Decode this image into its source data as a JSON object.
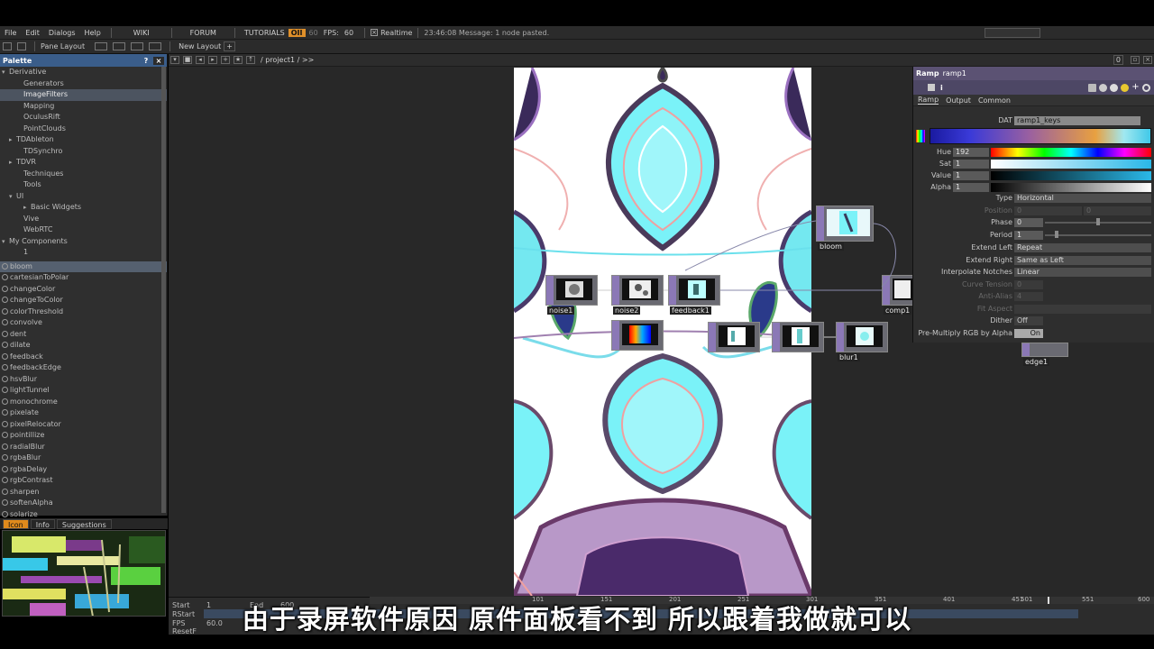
{
  "menubar": {
    "items": [
      "File",
      "Edit",
      "Dialogs",
      "Help"
    ],
    "wiki": "WIKI",
    "forum": "FORUM",
    "tutorials": "TUTORIALS",
    "oi": "OII",
    "sixty": "60",
    "fps_label": "FPS:",
    "fps_value": "60",
    "realtime": "Realtime",
    "message": "23:46:08 Message: 1 node pasted."
  },
  "toolbar2": {
    "pane_layout": "Pane Layout",
    "new_layout": "New Layout",
    "plus": "+"
  },
  "palette": {
    "title": "Palette",
    "help": "?",
    "close": "×",
    "tree": [
      {
        "label": "Derivative",
        "indent": 0,
        "tri": "▾"
      },
      {
        "label": "Generators",
        "indent": 2,
        "tri": ""
      },
      {
        "label": "ImageFilters",
        "indent": 2,
        "tri": "",
        "selected": true
      },
      {
        "label": "Mapping",
        "indent": 2,
        "tri": ""
      },
      {
        "label": "OculusRift",
        "indent": 2,
        "tri": ""
      },
      {
        "label": "PointClouds",
        "indent": 2,
        "tri": ""
      },
      {
        "label": "TDAbleton",
        "indent": 1,
        "tri": "▸"
      },
      {
        "label": "TDSynchro",
        "indent": 2,
        "tri": ""
      },
      {
        "label": "TDVR",
        "indent": 1,
        "tri": "▸"
      },
      {
        "label": "Techniques",
        "indent": 2,
        "tri": ""
      },
      {
        "label": "Tools",
        "indent": 2,
        "tri": ""
      },
      {
        "label": "UI",
        "indent": 1,
        "tri": "▾"
      },
      {
        "label": "Basic Widgets",
        "indent": 3,
        "tri": "▸"
      },
      {
        "label": "Vive",
        "indent": 2,
        "tri": ""
      },
      {
        "label": "WebRTC",
        "indent": 2,
        "tri": ""
      },
      {
        "label": "My Components",
        "indent": 0,
        "tri": "▾"
      },
      {
        "label": "1",
        "indent": 2,
        "tri": ""
      }
    ],
    "components": [
      "bloom",
      "cartesianToPolar",
      "changeColor",
      "changeToColor",
      "colorThreshold",
      "convolve",
      "dent",
      "dilate",
      "feedback",
      "feedbackEdge",
      "hsvBlur",
      "lightTunnel",
      "monochrome",
      "pixelate",
      "pixelRelocator",
      "pointillize",
      "radialBlur",
      "rgbaBlur",
      "rgbaDelay",
      "rgbContrast",
      "sharpen",
      "softenAlpha",
      "solarize"
    ],
    "tabs": [
      "Icon",
      "Info",
      "Suggestions"
    ]
  },
  "network": {
    "path": "/ project1 / >>",
    "page_num": "0",
    "nodes": [
      {
        "id": "bloom",
        "label": "bloom"
      },
      {
        "id": "noise1",
        "label": "noise1"
      },
      {
        "id": "noise2",
        "label": "noise2"
      },
      {
        "id": "feedback",
        "label": "feedback1"
      },
      {
        "id": "ramp",
        "label": ""
      },
      {
        "id": "comp1",
        "label": "comp1"
      },
      {
        "id": "blur1",
        "label": "blur1"
      },
      {
        "id": "edge1",
        "label": "edge1"
      },
      {
        "id": "mid1",
        "label": ""
      },
      {
        "id": "mid2",
        "label": ""
      }
    ]
  },
  "params": {
    "op_type": "Ramp",
    "op_name": "ramp1",
    "tabs": [
      "Ramp",
      "Output",
      "Common"
    ],
    "dat_label": "DAT",
    "dat_value": "ramp1_keys",
    "hue_label": "Hue",
    "hue_value": "192",
    "sat_label": "Sat",
    "sat_value": "1",
    "value_label": "Value",
    "value_value": "1",
    "alpha_label": "Alpha",
    "alpha_value": "1",
    "type_label": "Type",
    "type_value": "Horizontal",
    "position_label": "Position",
    "position_v1": "0",
    "position_v2": "0",
    "phase_label": "Phase",
    "phase_value": "0",
    "period_label": "Period",
    "period_value": "1",
    "extend_left_label": "Extend Left",
    "extend_left_value": "Repeat",
    "extend_right_label": "Extend Right",
    "extend_right_value": "Same as Left",
    "interp_label": "Interpolate Notches",
    "interp_value": "Linear",
    "curve_label": "Curve Tension",
    "curve_value": "0",
    "antialias_label": "Anti-Alias",
    "antialias_value": "4",
    "fit_label": "Fit Aspect",
    "dither_label": "Dither",
    "dither_value": "Off",
    "premult_label": "Pre-Multiply RGB by Alpha",
    "premult_value": "On"
  },
  "timeline": {
    "start_label": "Start",
    "start_value": "1",
    "end_label": "End",
    "end_value": "600",
    "rstart_label": "RStart",
    "fps_label": "FPS",
    "fps_value": "60.0",
    "resetf_label": "ResetF",
    "ticks": [
      "101",
      "151",
      "201",
      "251",
      "301",
      "351",
      "401",
      "451",
      "501",
      "551",
      "600"
    ]
  },
  "subtitle": "由于录屏软件原因 原件面板看不到 所以跟着我做就可以",
  "colors": {
    "accent_orange": "#e08a1c",
    "palette_header": "#3a5d8a",
    "param_header": "#5b5273",
    "node_strip": "#8b78b6"
  }
}
